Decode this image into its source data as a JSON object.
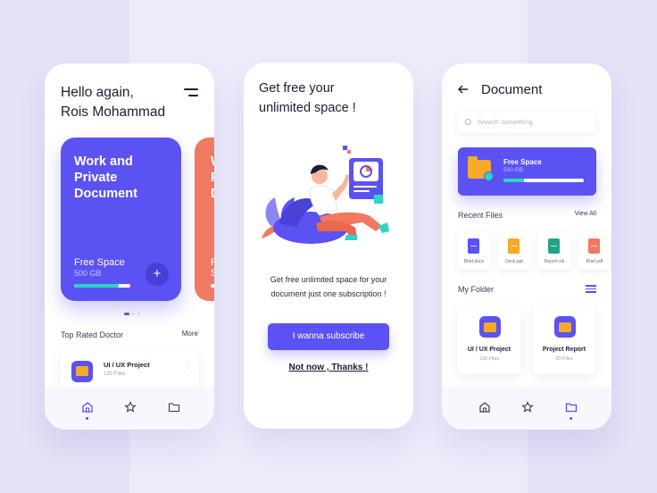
{
  "colors": {
    "accent": "#5a52f3",
    "coral": "#f07a61",
    "folder": "#f7a928",
    "teal": "#2ed4c4"
  },
  "screen1": {
    "greeting_line1": "Hello again,",
    "greeting_line2": "Rois Mohammad",
    "card": {
      "title": "Work and Private Document",
      "free_label": "Free Space",
      "size": "500 GB",
      "usage_fraction": 0.8
    },
    "section_title": "Top Rated Doctor",
    "section_more": "More",
    "list_item": {
      "title": "UI / UX Project",
      "subtitle": "130 Files"
    },
    "nav": [
      "home-icon",
      "star-icon",
      "folder-icon"
    ]
  },
  "screen2": {
    "title": "Get free your unlimited space !",
    "description": "Get free unlimited space for your document just one subscription !",
    "subscribe_label": "I wanna subscribe",
    "dismiss_label": "Not now , Thanks !"
  },
  "screen3": {
    "title": "Document",
    "search_placeholder": "Search Something",
    "storage": {
      "label": "Free Space",
      "size": "500 GB",
      "usage_fraction": 0.25
    },
    "recent_title": "Recent Files",
    "view_all": "View All",
    "recent_files": [
      {
        "name": "Brief.docs",
        "color": "#5a52f3"
      },
      {
        "name": "Deck.ppt",
        "color": "#f7a928"
      },
      {
        "name": "Report.xls",
        "color": "#23a389"
      },
      {
        "name": "Brief.pdf",
        "color": "#f07a61"
      }
    ],
    "folder_title": "My Folder",
    "folders": [
      {
        "name": "UI / UX Project",
        "count": "130 Files"
      },
      {
        "name": "Project Report",
        "count": "30 Files"
      }
    ]
  }
}
